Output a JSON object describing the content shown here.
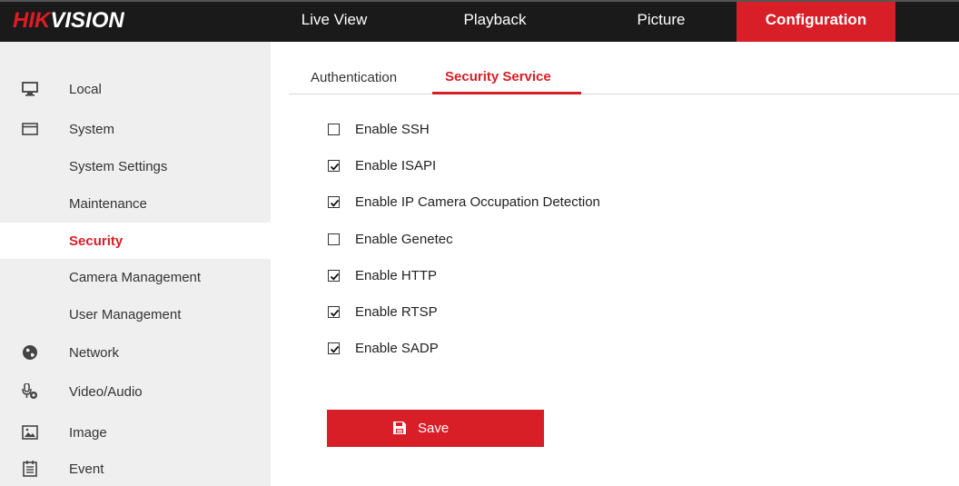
{
  "header": {
    "logo_red": "HIK",
    "logo_white": "VISION",
    "nav": [
      {
        "label": "Live View",
        "active": false
      },
      {
        "label": "Playback",
        "active": false
      },
      {
        "label": "Picture",
        "active": false
      },
      {
        "label": "Configuration",
        "active": true
      }
    ]
  },
  "sidebar": {
    "items": [
      {
        "label": "Local",
        "icon": "monitor-icon",
        "level": 1
      },
      {
        "label": "System",
        "icon": "system-icon",
        "level": 1
      },
      {
        "label": "System Settings",
        "level": 2
      },
      {
        "label": "Maintenance",
        "level": 2
      },
      {
        "label": "Security",
        "level": 2,
        "selected": true
      },
      {
        "label": "Camera Management",
        "level": 2
      },
      {
        "label": "User Management",
        "level": 2
      },
      {
        "label": "Network",
        "icon": "globe-icon",
        "level": 1
      },
      {
        "label": "Video/Audio",
        "icon": "microphone-icon",
        "level": 1
      },
      {
        "label": "Image",
        "icon": "image-icon",
        "level": 1
      },
      {
        "label": "Event",
        "icon": "calendar-icon",
        "level": 1
      }
    ]
  },
  "tabs": [
    {
      "label": "Authentication",
      "active": false
    },
    {
      "label": "Security Service",
      "active": true
    }
  ],
  "options": [
    {
      "label": "Enable SSH",
      "checked": false
    },
    {
      "label": "Enable ISAPI",
      "checked": true
    },
    {
      "label": "Enable IP Camera Occupation Detection",
      "checked": true
    },
    {
      "label": "Enable Genetec",
      "checked": false
    },
    {
      "label": "Enable HTTP",
      "checked": true
    },
    {
      "label": "Enable RTSP",
      "checked": true
    },
    {
      "label": "Enable SADP",
      "checked": true
    }
  ],
  "save": {
    "label": "Save",
    "icon": "save-icon"
  },
  "colors": {
    "accent": "#d81e26",
    "topbar": "#1a1a1a",
    "sidebar": "#efefef"
  }
}
